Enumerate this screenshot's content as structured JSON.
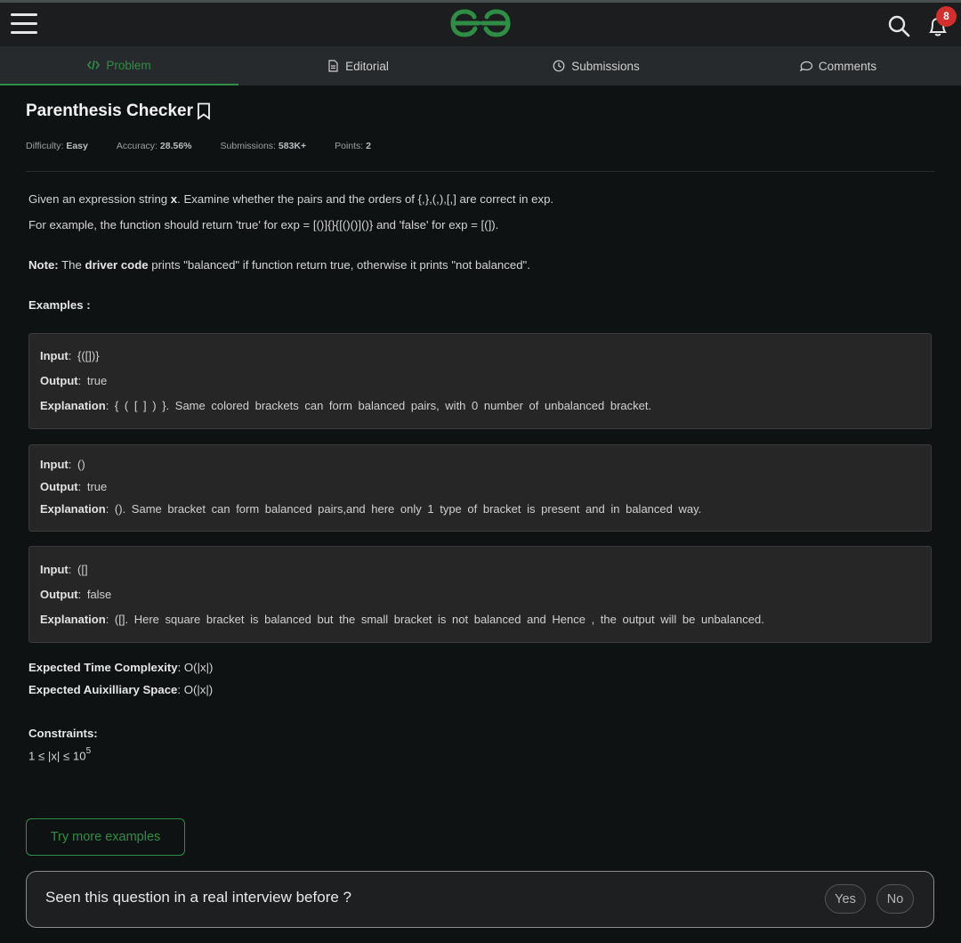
{
  "header": {
    "notification_count": "8",
    "brand_color": "#2f8d46"
  },
  "tabs": [
    {
      "label": "Problem",
      "icon": "code-icon",
      "active": true
    },
    {
      "label": "Editorial",
      "icon": "document-icon"
    },
    {
      "label": "Submissions",
      "icon": "clock-icon"
    },
    {
      "label": "Comments",
      "icon": "comment-icon"
    }
  ],
  "problem": {
    "title": "Parenthesis Checker",
    "meta": {
      "difficulty_label": "Difficulty:",
      "difficulty": "Easy",
      "accuracy_label": "Accuracy:",
      "accuracy": "28.56%",
      "submissions_label": "Submissions:",
      "submissions": "583K+",
      "points_label": "Points:",
      "points": "2"
    },
    "desc1_a": "Given an expression string ",
    "desc1_var": "x",
    "desc1_b": ". Examine whether the pairs and the orders of {,},(,),[,] are correct in exp.",
    "desc2": "For example, the function should return 'true' for exp = [()]{}{[()()]()} and 'false' for exp = [(]).",
    "note_label": "Note:",
    "note_a": " The ",
    "note_bold": "driver code",
    "note_b": " prints \"balanced\" if function return true, otherwise it prints \"not balanced\".",
    "examples_heading": "Examples :",
    "examples": [
      {
        "input_label": "Input",
        "input": "{([])}",
        "output_label": "Output",
        "output": "true",
        "explanation_label": "Explanation",
        "explanation": "{ ( [ ] ) }. Same colored brackets can form balanced pairs, with 0 number of unbalanced bracket."
      },
      {
        "input_label": "Input",
        "input": "()",
        "output_label": "Output",
        "output": "true",
        "explanation_label": "Explanation",
        "explanation": "(). Same bracket can form balanced pairs,and here only 1 type of bracket is present and in balanced way."
      },
      {
        "input_label": "Input",
        "input": "([]",
        "output_label": "Output",
        "output": "false",
        "explanation_label": "Explanation",
        "explanation": "([]. Here square bracket is balanced but the small bracket is not balanced and Hence , the output will be unbalanced."
      }
    ],
    "time_label": "Expected Time Complexity",
    "time_value": ": O(|x|)",
    "space_label": "Expected Auixilliary Space",
    "space_value": ": O(|x|)",
    "constraints_label": "Constraints:",
    "constraint_base": "1 ≤ |x| ≤ 10",
    "constraint_exp": "5"
  },
  "actions": {
    "try_more": "Try more examples"
  },
  "interview": {
    "question": "Seen this question in a real interview before ?",
    "yes": "Yes",
    "no": "No"
  }
}
